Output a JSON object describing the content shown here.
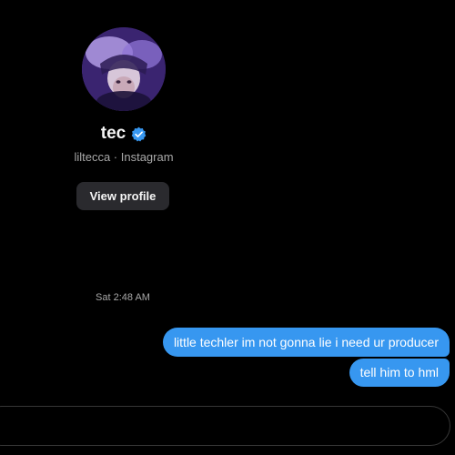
{
  "profile": {
    "display_name": "tec",
    "subtitle": "liltecca · Instagram",
    "view_profile_label": "View profile",
    "verified_icon": "verified-badge-icon",
    "verified_color": "#3797f0"
  },
  "thread": {
    "timestamp": "Sat 2:48 AM",
    "messages": [
      {
        "text": "little techler im not gonna lie i need ur producer",
        "sender": "me"
      },
      {
        "text": "tell him to hml",
        "sender": "me"
      }
    ]
  },
  "composer": {
    "value": "",
    "placeholder": ""
  },
  "colors": {
    "background": "#000000",
    "bubble": "#3797f0",
    "button_bg": "#2a2a2e",
    "muted_text": "#a8a8a8"
  }
}
